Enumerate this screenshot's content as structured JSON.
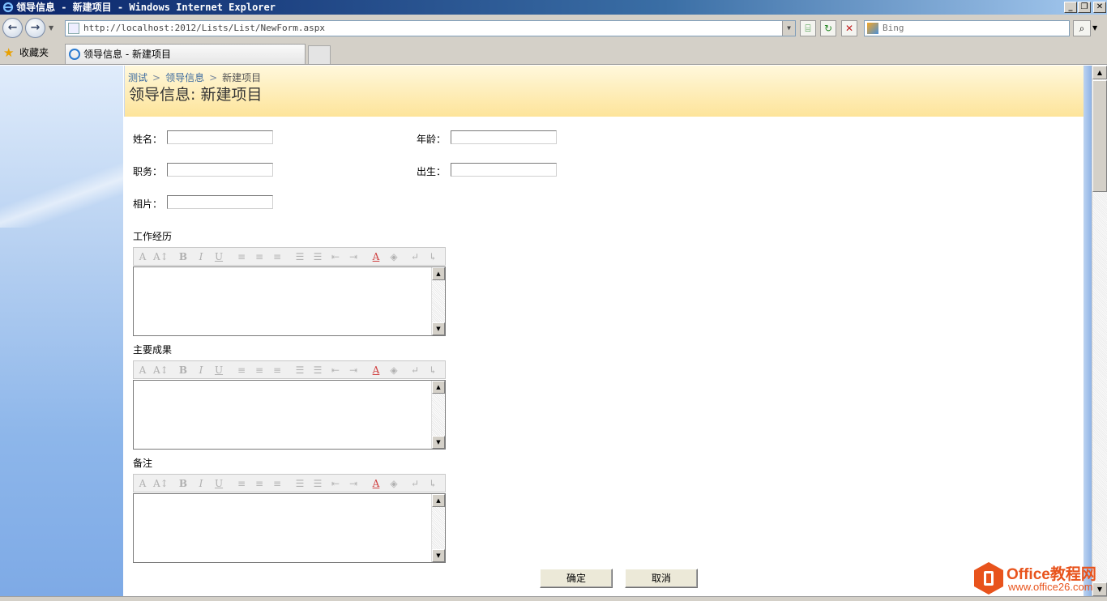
{
  "window": {
    "title": "领导信息 - 新建项目 - Windows Internet Explorer",
    "minimize": "_",
    "maximize": "❐",
    "close": "✕"
  },
  "nav": {
    "back": "←",
    "forward": "→",
    "address": "http://localhost:2012/Lists/List/NewForm.aspx",
    "search_placeholder": "Bing"
  },
  "favorites": {
    "label": "收藏夹",
    "tab_title": "领导信息 - 新建项目"
  },
  "page": {
    "breadcrumb": [
      "测试",
      "领导信息",
      "新建项目"
    ],
    "breadcrumb_sep": ">",
    "title": "领导信息: 新建项目"
  },
  "form": {
    "name_label": "姓名：",
    "age_label": "年龄：",
    "position_label": "职务：",
    "birth_label": "出生：",
    "photo_label": "相片：",
    "work_history_label": "工作经历",
    "achievements_label": "主要成果",
    "notes_label": "备注",
    "name_value": "",
    "age_value": "",
    "position_value": "",
    "birth_value": "",
    "photo_value": ""
  },
  "buttons": {
    "ok": "确定",
    "cancel": "取消"
  },
  "watermark": {
    "brand": "Office教程网",
    "url": "www.office26.com"
  }
}
